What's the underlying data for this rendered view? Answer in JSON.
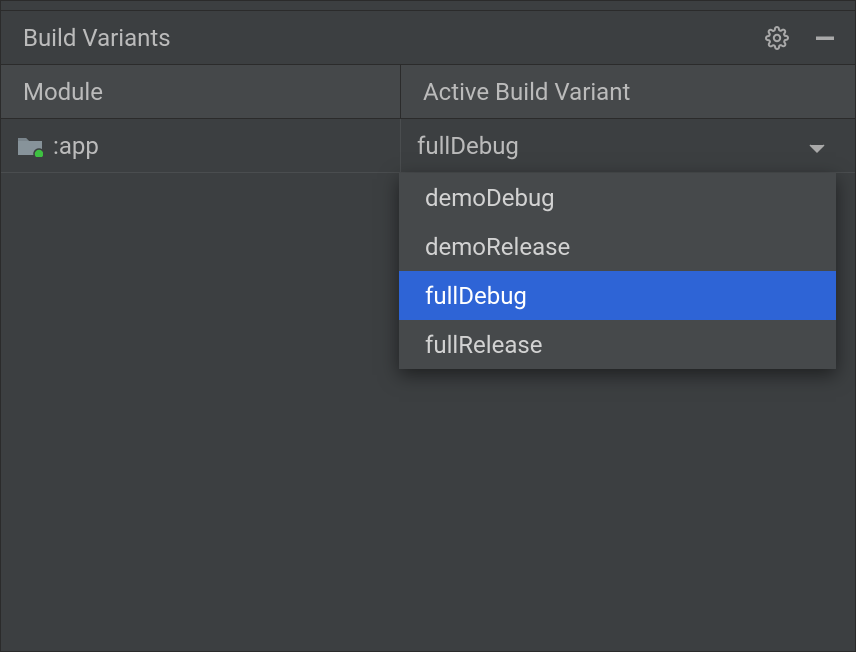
{
  "panel": {
    "title": "Build Variants"
  },
  "columns": {
    "module": "Module",
    "variant": "Active Build Variant"
  },
  "row": {
    "module": ":app",
    "variant": "fullDebug"
  },
  "dropdown": {
    "options": [
      {
        "label": "demoDebug"
      },
      {
        "label": "demoRelease"
      },
      {
        "label": "fullDebug"
      },
      {
        "label": "fullRelease"
      }
    ],
    "selected_index": 2
  }
}
